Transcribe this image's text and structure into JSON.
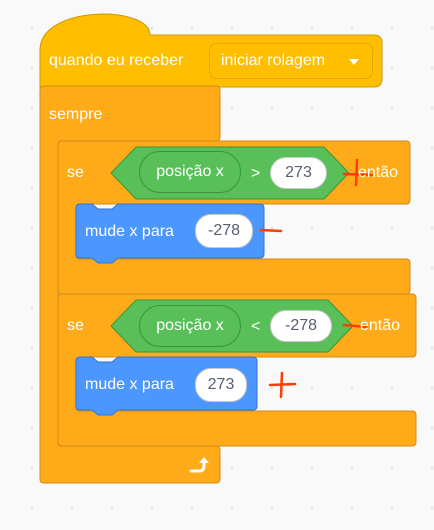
{
  "hat_block": {
    "label": "quando eu receber",
    "message": "iniciar rolagem",
    "dropdown_icon": "triangle-down-icon"
  },
  "forever_block": {
    "label": "sempre",
    "loop_icon": "loop-arrow-icon"
  },
  "if_blocks": [
    {
      "if_label": "se",
      "then_label": "então",
      "condition": {
        "reporter": "posição x",
        "operator": ">",
        "value": "273"
      },
      "action": {
        "label": "mude x para",
        "value": "-278"
      }
    },
    {
      "if_label": "se",
      "then_label": "então",
      "condition": {
        "reporter": "posição x",
        "operator": "<",
        "value": "-278"
      },
      "action": {
        "label": "mude x para",
        "value": "273"
      }
    }
  ],
  "annotations": [
    "+",
    "-",
    "-",
    "+"
  ],
  "colors": {
    "events": "#ffbf00",
    "control": "#ffab19",
    "operators": "#59c059",
    "motion": "#4c97ff",
    "annotation": "#ff3d00"
  }
}
